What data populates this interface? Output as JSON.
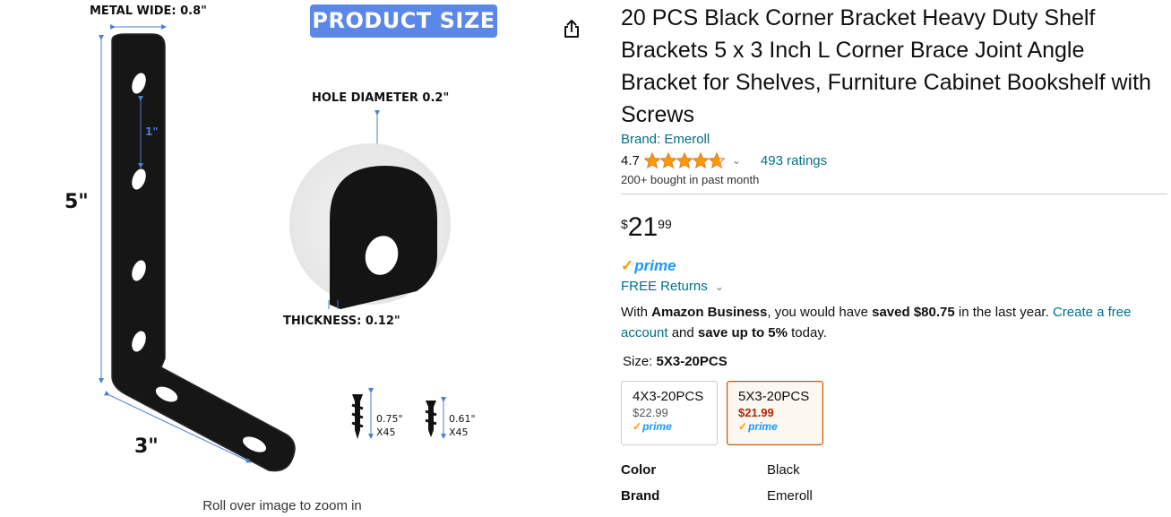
{
  "image": {
    "banner": "PRODUCT SIZE",
    "metal_wide": "METAL WIDE: 0.8\"",
    "spacing": "1\"",
    "height": "5\"",
    "length": "3\"",
    "hole_diameter": "HOLE DIAMETER 0.2\"",
    "thickness": "THICKNESS: 0.12\"",
    "screw1_len": "0.75\"",
    "screw1_qty": "X45",
    "screw2_len": "0.61\"",
    "screw2_qty": "X45",
    "zoom_hint": "Roll over image to zoom in",
    "share_icon": "share-icon"
  },
  "product": {
    "title": "20 PCS Black Corner Bracket Heavy Duty Shelf Brackets 5 x 3 Inch L Corner Brace Joint Angle Bracket for Shelves, Furniture Cabinet Bookshelf with Screws",
    "brand": "Brand: Emeroll",
    "rating": "4.7",
    "stars": 4.7,
    "ratings_count": "493 ratings",
    "bought": "200+ bought in past month"
  },
  "price": {
    "symbol": "$",
    "whole": "21",
    "fraction": "99"
  },
  "prime": {
    "logo": "prime",
    "free_returns": "FREE Returns"
  },
  "business": {
    "t1": "With ",
    "b1": "Amazon Business",
    "t2": ", you would have ",
    "b2": "saved $80.75",
    "t3": " in the last year. ",
    "link": "Create a free account",
    "t4": " and ",
    "b3": "save up to 5%",
    "t5": " today."
  },
  "size": {
    "label": "Size: ",
    "selected": "5X3-20PCS",
    "options": [
      {
        "name": "4X3-20PCS",
        "price": "$22.99",
        "prime": "prime"
      },
      {
        "name": "5X3-20PCS",
        "price": "$21.99",
        "prime": "prime"
      }
    ]
  },
  "specs": [
    {
      "key": "Color",
      "value": "Black"
    },
    {
      "key": "Brand",
      "value": "Emeroll"
    }
  ],
  "colors": {
    "banner": "#5b88e8",
    "link": "#007185",
    "star": "#ff9900",
    "prime_blue": "#1a98ff",
    "deal_red": "#b12704",
    "selected_border": "#c45500"
  }
}
